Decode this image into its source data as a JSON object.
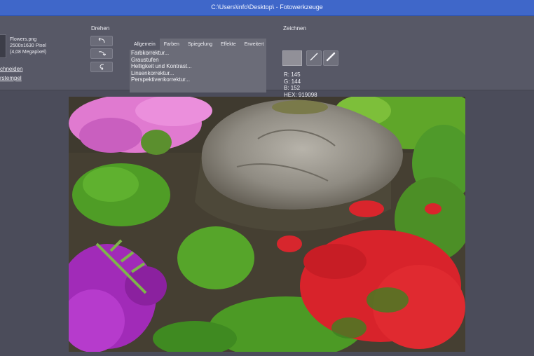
{
  "window": {
    "title": "C:\\Users\\info\\Desktop\\ - Fotowerkzeuge"
  },
  "file": {
    "name": "Flowers.png",
    "dimensions": "2500x1630 Pixel",
    "megapixel": "(4,08 Megapixel)"
  },
  "links": {
    "crop": "chneiden",
    "stamp": "rstempel"
  },
  "rotate": {
    "label": "Drehen",
    "icons": [
      "rotate-left-icon",
      "rotate-right-icon",
      "rotate-180-icon"
    ]
  },
  "adjust": {
    "tabs": [
      "Allgemein",
      "Farben",
      "Spiegelung",
      "Effekte",
      "Erweitert"
    ],
    "active_tab": "Allgemein",
    "items": [
      "Farbkorrektur...",
      "Graustufen",
      "Helligkeit und Kontrast...",
      "Linsenkorrektur...",
      "Perspektivenkorrektur..."
    ]
  },
  "draw": {
    "label": "Zeichnen",
    "color_hex": "#919098",
    "r": "R: 145",
    "g": "G: 144",
    "b": "B: 152",
    "hex": "HEX: 919098",
    "tools": [
      "line-icon",
      "pen-icon"
    ]
  },
  "image": {
    "subject": "garden-flowers-photo"
  }
}
